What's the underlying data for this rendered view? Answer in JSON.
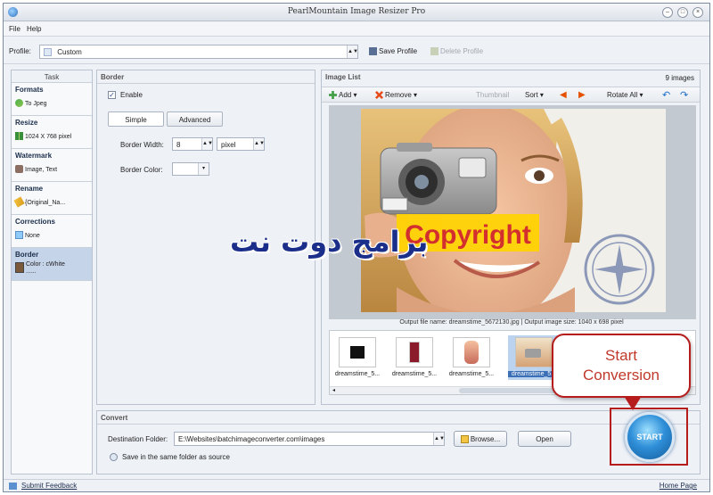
{
  "window": {
    "title": "PearlMountain Image Resizer Pro"
  },
  "menu": [
    {
      "label": "File"
    },
    {
      "label": "Help"
    }
  ],
  "profile": {
    "label": "Profile:",
    "value": "Custom",
    "save_label": "Save Profile",
    "delete_label": "Delete Profile"
  },
  "task_pane": {
    "header": "Task",
    "items": [
      {
        "title": "Formats",
        "value": "To Jpeg"
      },
      {
        "title": "Resize",
        "value": "1024 X 768 pixel"
      },
      {
        "title": "Watermark",
        "value": "Image, Text"
      },
      {
        "title": "Rename",
        "value": "{Original_Na..."
      },
      {
        "title": "Corrections",
        "value": "None"
      },
      {
        "title": "Border",
        "value": "Color : cWhite",
        "value2": "......"
      }
    ]
  },
  "border_panel": {
    "header": "Border",
    "enable_label": "Enable",
    "enable_checked": true,
    "tab_simple": "Simple",
    "tab_advanced": "Advanced",
    "width_label": "Border Width:",
    "width_value": "8",
    "width_unit": "pixel",
    "color_label": "Border Color:"
  },
  "image_list": {
    "header": "Image List",
    "count": "9 images",
    "add_label": "Add",
    "remove_label": "Remove",
    "thumbnail_label": "Thumbnail",
    "sort_label": "Sort",
    "rotate_label": "Rotate All",
    "watermark_text": "Copyright",
    "caption": "Output file name: dreamstime_5672130.jpg | Output image size: 1040 x 698 pixel",
    "thumbs": [
      {
        "label": "dreamstime_5..."
      },
      {
        "label": "dreamstime_5..."
      },
      {
        "label": "dreamstime_5..."
      },
      {
        "label": "dreamstime_5..."
      }
    ]
  },
  "convert": {
    "header": "Convert",
    "dest_label": "Destination Folder:",
    "dest_value": "E:\\Websites\\batchimageconverter.com\\images",
    "browse_label": "Browse...",
    "open_label": "Open",
    "same_folder_label": "Save in the same folder as source",
    "start_label": "START"
  },
  "callout": {
    "line1": "Start",
    "line2": "Conversion"
  },
  "overlay_text": "برامج دوت نت",
  "status": {
    "feedback": "Submit Feedback",
    "home": "Home Page"
  },
  "colors": {
    "accent_red": "#b71c1c",
    "start_blue": "#2f8fd8",
    "overlay_blue": "#1b2f8a"
  }
}
